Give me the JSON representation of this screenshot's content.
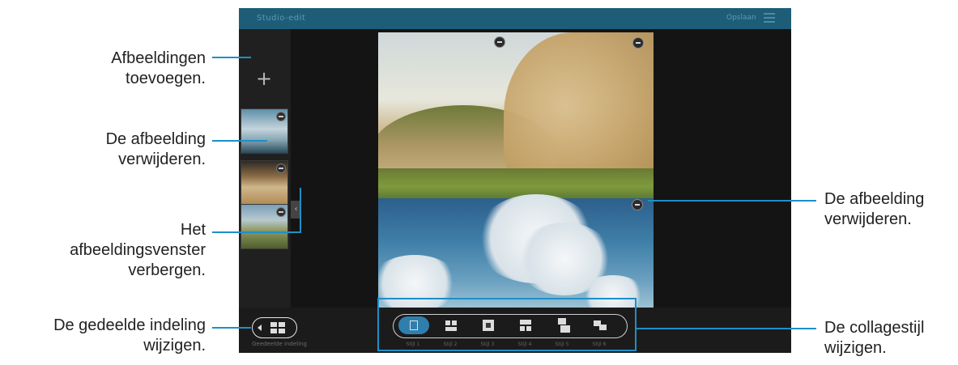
{
  "app": {
    "title": "Studio-edit",
    "save_label": "Opslaan",
    "split_label": "Geedeelde indeling",
    "style_labels": [
      "Stijl 1",
      "Stijl 2",
      "Stijl 3",
      "Stijl 4",
      "Stijl 5",
      "Stijl 6"
    ]
  },
  "icons": {
    "add": "+",
    "hide_panel": "‹"
  },
  "callouts": {
    "add_images": [
      "Afbeeldingen",
      "toevoegen."
    ],
    "remove_image_left": [
      "De afbeelding",
      "verwijderen."
    ],
    "hide_panel": [
      "Het",
      "afbeeldingsvenster",
      "verbergen."
    ],
    "change_split": [
      "De gedeelde indeling",
      "wijzigen."
    ],
    "remove_image_right": [
      "De afbeelding",
      "verwijderen."
    ],
    "change_collage": [
      "De collagestijl",
      "wijzigen."
    ]
  },
  "colors": {
    "accent": "#1d8fc9",
    "topbar": "#1d5d78",
    "active_style": "#2f7fae"
  }
}
